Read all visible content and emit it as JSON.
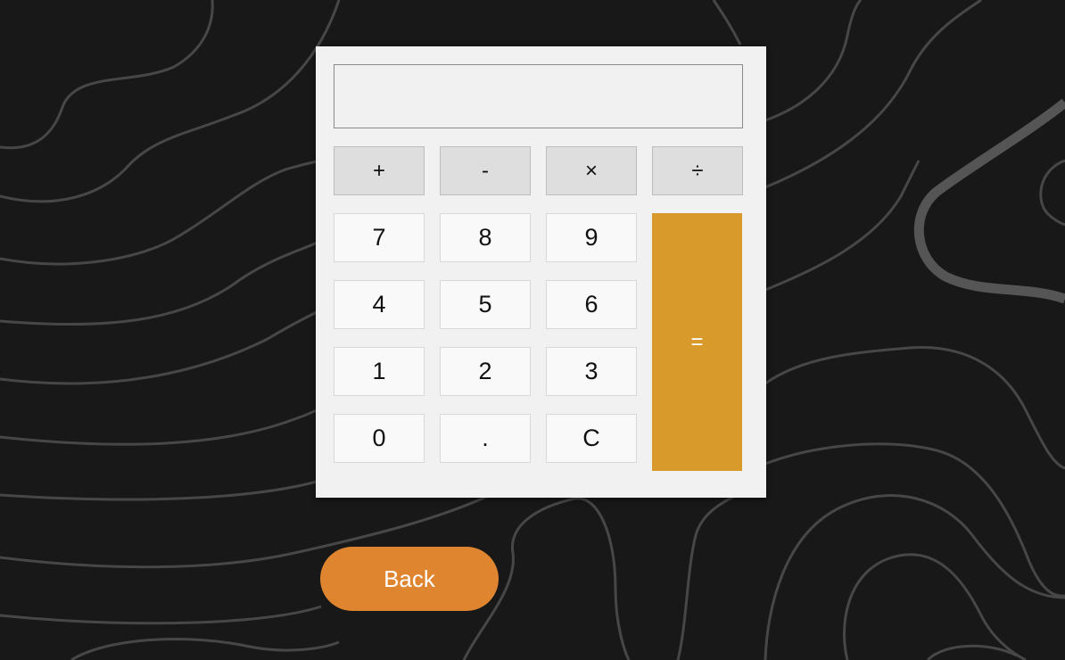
{
  "display": {
    "value": "",
    "placeholder": ""
  },
  "operators": {
    "add": "+",
    "subtract": "-",
    "multiply": "×",
    "divide": "÷"
  },
  "digits": {
    "seven": "7",
    "eight": "8",
    "nine": "9",
    "four": "4",
    "five": "5",
    "six": "6",
    "one": "1",
    "two": "2",
    "three": "3",
    "zero": "0",
    "decimal": ".",
    "clear": "C"
  },
  "equals_label": "=",
  "back_label": "Back",
  "colors": {
    "background": "#181818",
    "contour_lines": "#4a4a4a",
    "equals_button": "#d89a2a",
    "back_button": "#e0852f",
    "calculator_panel": "#f1f1f1"
  }
}
